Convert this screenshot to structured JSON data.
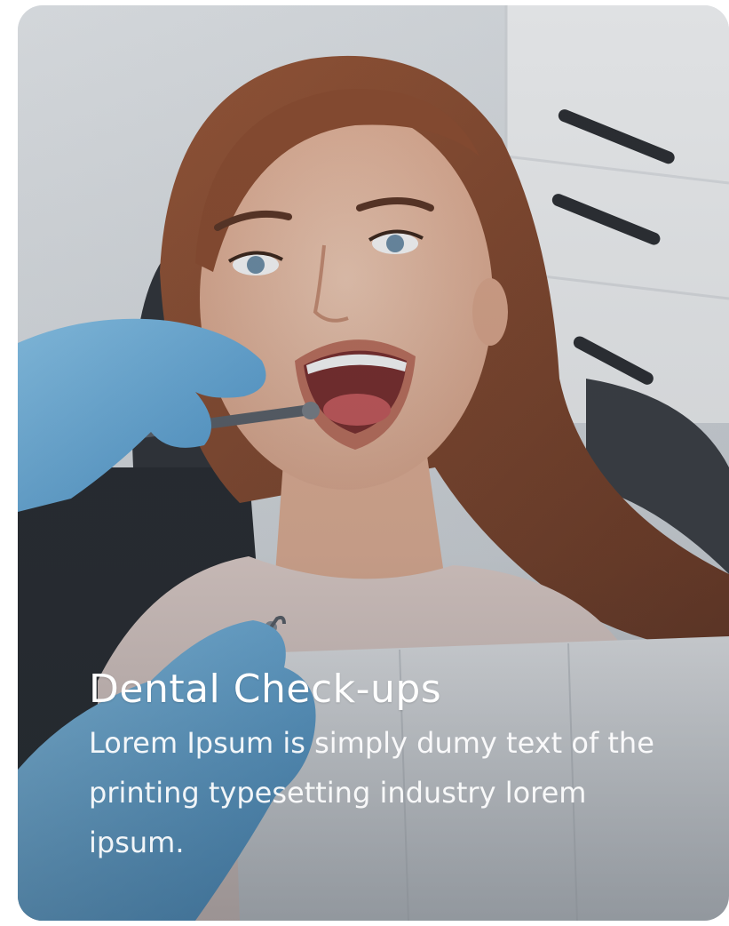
{
  "card": {
    "title": "Dental Check-ups",
    "description": "Lorem Ipsum is simply dumy text of the printing typesetting industry lorem ipsum."
  },
  "image": {
    "icon": "dental-checkup-photo"
  },
  "colors": {
    "glove": "#6fb7e6",
    "hair": "#8a4a2e",
    "skin": "#e8b9a0",
    "caption_text": "#ffffff"
  }
}
